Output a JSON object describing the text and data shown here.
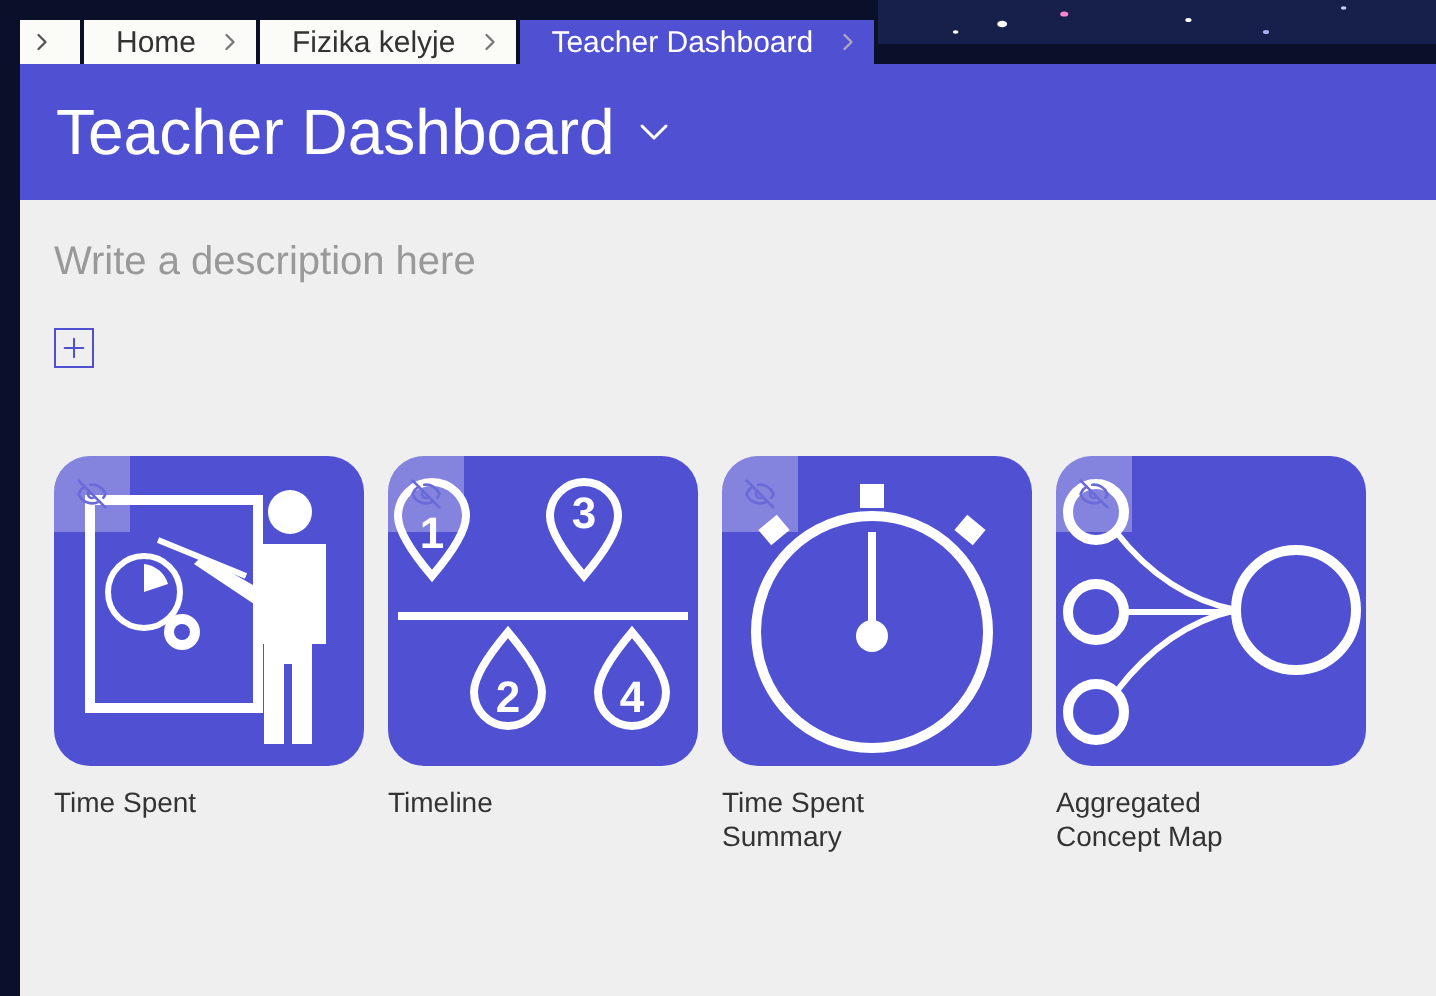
{
  "breadcrumb": [
    {
      "label": "Home",
      "selected": false
    },
    {
      "label": "Fizika kelyje",
      "selected": false
    },
    {
      "label": "Teacher Dashboard",
      "selected": true
    }
  ],
  "header": {
    "title": "Teacher Dashboard"
  },
  "description": {
    "placeholder": "Write a description here"
  },
  "tiles": [
    {
      "kind": "teacher",
      "label": "Time Spent",
      "hidden": true
    },
    {
      "kind": "timeline",
      "label": "Timeline",
      "hidden": true,
      "markers": [
        "1",
        "3",
        "2",
        "4"
      ]
    },
    {
      "kind": "stopwatch",
      "label": "Time Spent Summary",
      "hidden": true
    },
    {
      "kind": "concept-map",
      "label": "Aggregated Concept Map",
      "hidden": true
    }
  ]
}
